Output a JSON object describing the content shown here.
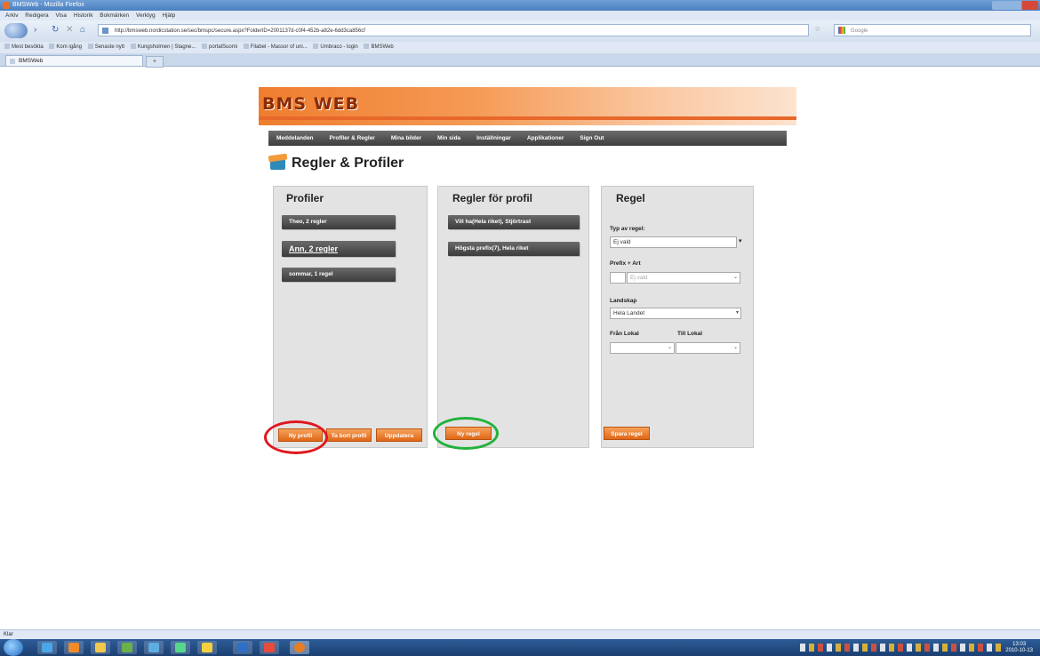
{
  "browser": {
    "window_title": "BMSWeb - Mozilla Firefox",
    "menu": [
      "Arkiv",
      "Redigera",
      "Visa",
      "Historik",
      "Bokmärken",
      "Verktyg",
      "Hjälp"
    ],
    "url": "http://bmsweb.nordicstation.se/sec/bmspc/secure.aspx?FolderID=2001137d-c0f4-452b-a82e-6dd3ca856cf",
    "search_placeholder": "Google",
    "bookmarks": [
      "Mest besökta",
      "Kom igång",
      "Senaste nytt",
      "Kungsholmen | Stagne...",
      "portalSuomi",
      "Filabel - Massor of uni...",
      "Umbraco - login",
      "BMSWeb"
    ],
    "tab_label": "BMSWeb",
    "new_tab_label": "+",
    "status_text": "Klar",
    "clock_time": "13:03",
    "clock_date": "2010-10-13"
  },
  "app": {
    "logo": "BMS WEB",
    "nav": [
      "Meddelanden",
      "Profiler & Regler",
      "Mina bilder",
      "Min sida",
      "Inställningar",
      "Applikationer",
      "Sign Out"
    ],
    "page_title": "Regler & Profiler"
  },
  "profiler": {
    "heading": "Profiler",
    "items": [
      "Theo, 2 regler",
      "Ann, 2 regler",
      "sommar, 1 regel"
    ],
    "buttons": {
      "new": "Ny profil",
      "delete": "Ta bort profil",
      "update": "Uppdatera"
    }
  },
  "regler": {
    "heading": "Regler för profil",
    "items": [
      "Vill ha(Hela riket), Stjörtrast",
      "Högsta prefix(7), Hela riket"
    ],
    "buttons": {
      "new": "Ny regel"
    }
  },
  "regel": {
    "heading": "Regel",
    "type_label": "Typ av regel:",
    "type_value": "Ej vald",
    "prefix_label": "Prefix + Art",
    "prefix_value": "",
    "art_value": "Ej vald",
    "landskap_label": "Landskap",
    "landskap_value": "Hela Landet",
    "fran_label": "Från Lokal",
    "till_label": "Till Lokal",
    "fran_value": "",
    "till_value": "",
    "save_button": "Spara regel"
  },
  "annotations": {
    "ring_red_color": "#e0171f",
    "ring_green_color": "#22b23a"
  }
}
